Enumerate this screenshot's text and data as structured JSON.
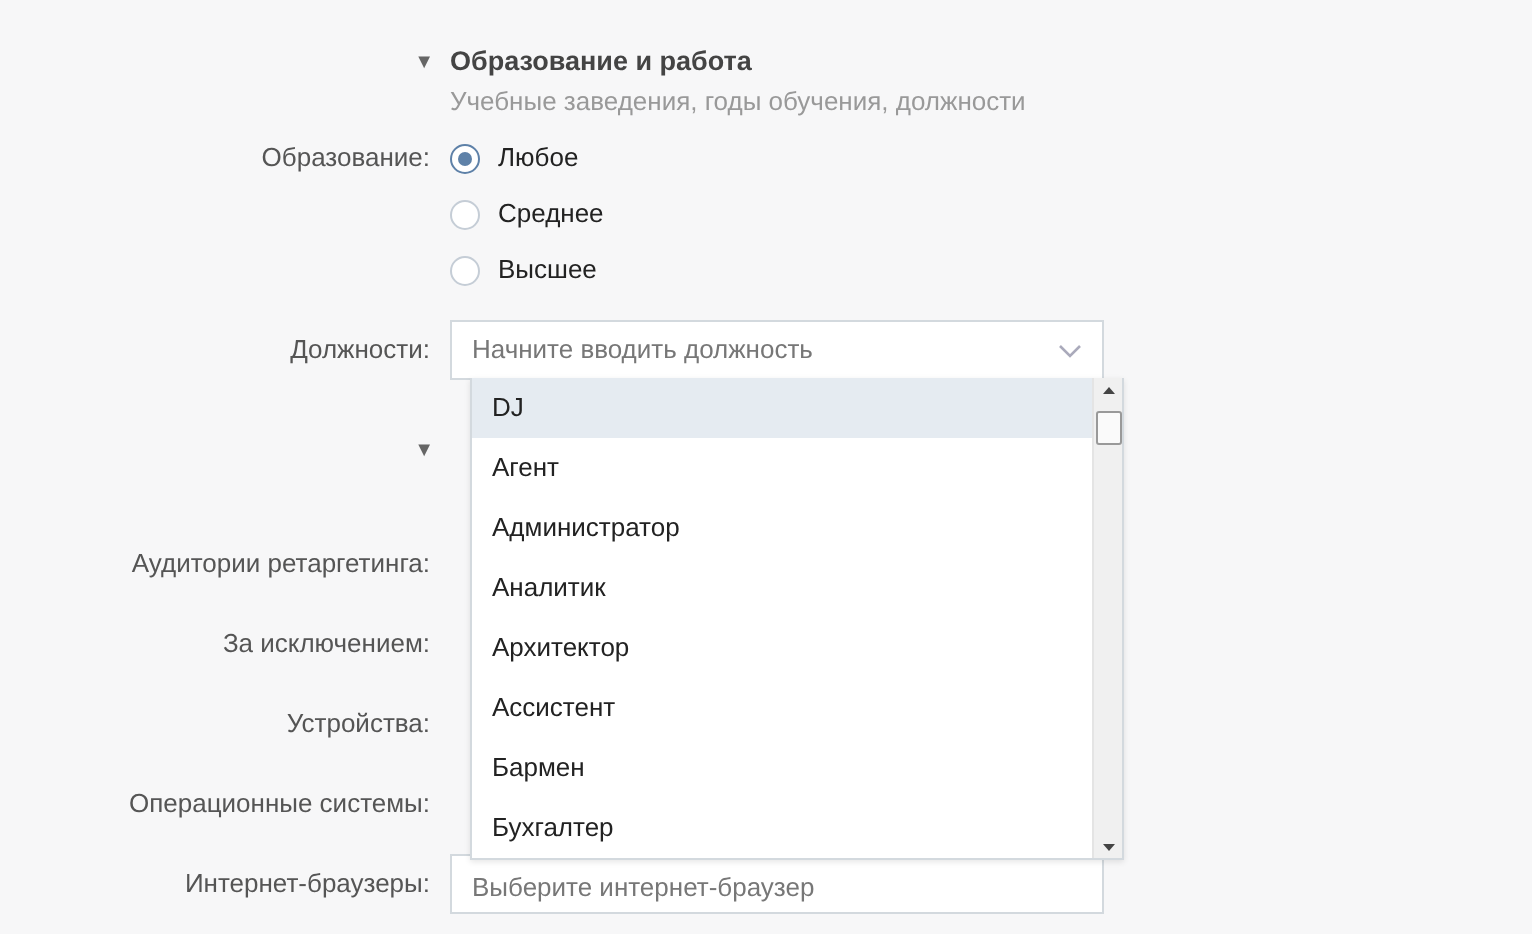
{
  "education_section": {
    "toggle": "▼",
    "title": "Образование и работа",
    "subtitle": "Учебные заведения, годы обучения, должности"
  },
  "education": {
    "label": "Образование:",
    "options": [
      {
        "label": "Любое",
        "selected": true
      },
      {
        "label": "Среднее",
        "selected": false
      },
      {
        "label": "Высшее",
        "selected": false
      }
    ]
  },
  "positions": {
    "label": "Должности:",
    "placeholder": "Начните вводить должность",
    "items": [
      {
        "label": "DJ",
        "selected": true
      },
      {
        "label": "Агент",
        "selected": false
      },
      {
        "label": "Администратор",
        "selected": false
      },
      {
        "label": "Аналитик",
        "selected": false
      },
      {
        "label": "Архитектор",
        "selected": false
      },
      {
        "label": "Ассистент",
        "selected": false
      },
      {
        "label": "Бармен",
        "selected": false
      },
      {
        "label": "Бухгалтер",
        "selected": false
      }
    ]
  },
  "next_section": {
    "toggle": "▼"
  },
  "fields": [
    {
      "label": "Аудитории ретаргетинга:"
    },
    {
      "label": "За исключением:"
    },
    {
      "label": "Устройства:"
    },
    {
      "label": "Операционные системы:"
    },
    {
      "label": "Интернет-браузеры:",
      "placeholder": "Выберите интернет-браузер"
    }
  ]
}
